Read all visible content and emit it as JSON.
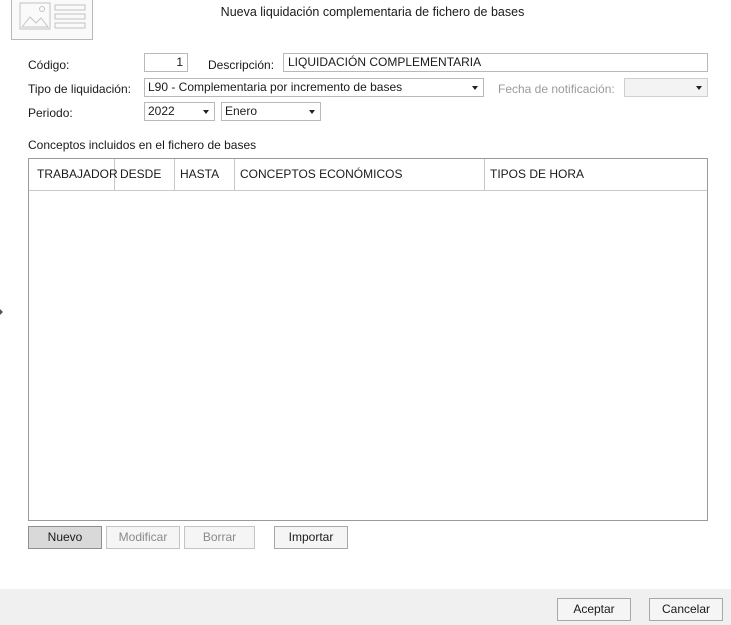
{
  "dialog": {
    "title": "Nueva liquidación complementaria de fichero de bases"
  },
  "form": {
    "codigo_label": "Código:",
    "codigo_value": "1",
    "descripcion_label": "Descripción:",
    "descripcion_value": "LIQUIDACIÓN COMPLEMENTARIA",
    "tipo_label": "Tipo de liquidación:",
    "tipo_value": "L90 - Complementaria por incremento de bases",
    "fecha_label": "Fecha de notificación:",
    "fecha_value": "",
    "periodo_label": "Periodo:",
    "periodo_year": "2022",
    "periodo_month": "Enero"
  },
  "grid": {
    "section_label": "Conceptos incluidos en el fichero de bases",
    "columns": [
      "TRABAJADOR",
      "DESDE",
      "HASTA",
      "CONCEPTOS ECONÓMICOS",
      "TIPOS DE HORA"
    ],
    "rows": []
  },
  "actions": {
    "nuevo": "Nuevo",
    "modificar": "Modificar",
    "borrar": "Borrar",
    "importar": "Importar"
  },
  "footer": {
    "aceptar": "Aceptar",
    "cancelar": "Cancelar"
  }
}
